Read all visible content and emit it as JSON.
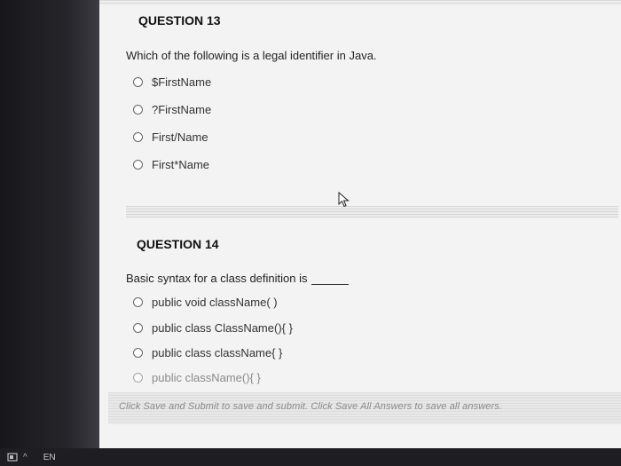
{
  "q13": {
    "title": "QUESTION 13",
    "text": "Which of the following is a legal identifier in Java.",
    "options": [
      "$FirstName",
      "?FirstName",
      "First/Name",
      "First*Name"
    ]
  },
  "q14": {
    "title": "QUESTION 14",
    "text": "Basic syntax for a class definition is",
    "options": [
      "public void className( )",
      "public class ClassName(){ }",
      "public class className{ }",
      "public className(){ }"
    ]
  },
  "footer": {
    "text": "Click Save and Submit to save and submit. Click Save All Answers to save all answers."
  },
  "taskbar": {
    "caret": "^",
    "lang": "EN"
  }
}
